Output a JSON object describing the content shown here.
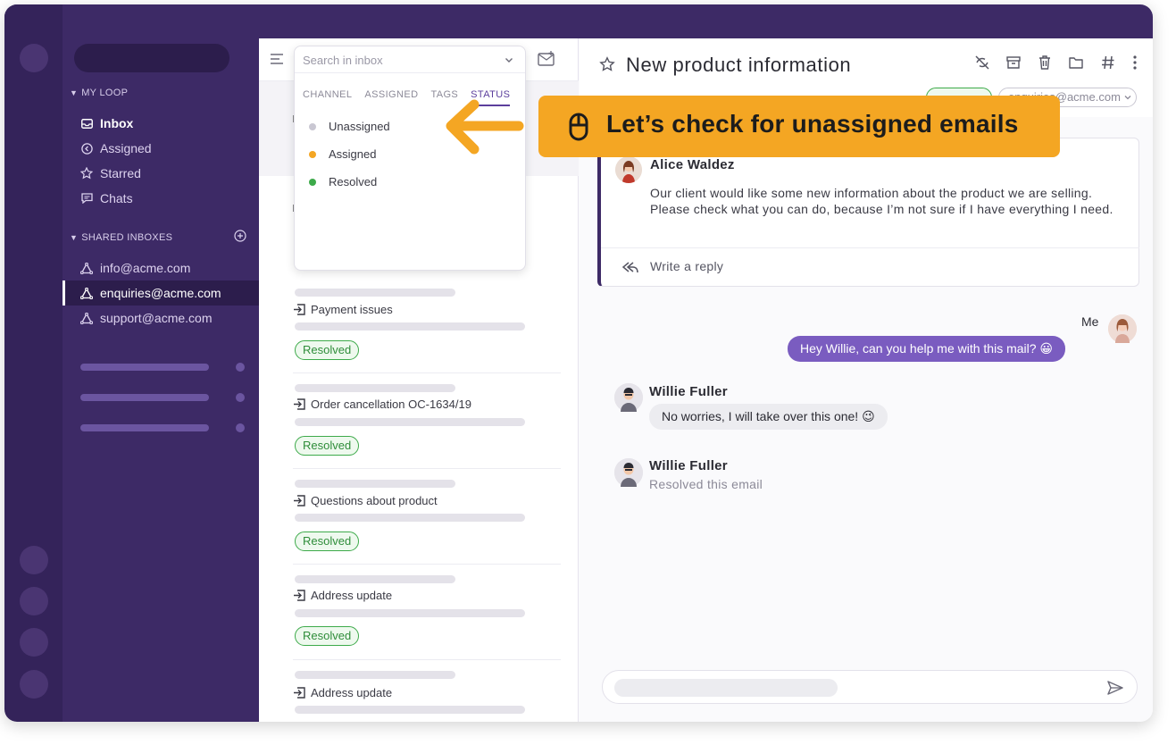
{
  "sidebar": {
    "my_loop_title": "MY LOOP",
    "my_loop_items": [
      "Inbox",
      "Assigned",
      "Starred",
      "Chats"
    ],
    "shared_title": "SHARED INBOXES",
    "shared_items": [
      "info@acme.com",
      "enquiries@acme.com",
      "support@acme.com"
    ]
  },
  "list": {
    "search_placeholder": "Search in inbox",
    "filter_tabs": [
      "CHANNEL",
      "ASSIGNED",
      "TAGS",
      "STATUS"
    ],
    "status_options": [
      {
        "label": "Unassigned",
        "color": "#c9c7d2"
      },
      {
        "label": "Assigned",
        "color": "#f4a623"
      },
      {
        "label": "Resolved",
        "color": "#3daa4a"
      }
    ],
    "items": [
      {
        "subject": "Payment issues",
        "badge": "Resolved"
      },
      {
        "subject": "Order cancellation OC-1634/19",
        "badge": "Resolved"
      },
      {
        "subject": "Questions about product",
        "badge": "Resolved"
      },
      {
        "subject": "Address update",
        "badge": "Resolved"
      },
      {
        "subject": "Address update"
      }
    ]
  },
  "detail": {
    "title": "New product information",
    "assignee_email": "enquiries@acme.com",
    "message": {
      "sender": "Alice Waldez",
      "body": "Our client would like some new information about the product we are selling. Please check what you can do, because I’m not sure if I have everything I need.",
      "reply_label": "Write a reply"
    },
    "chat": {
      "me_label": "Me",
      "me_message": "Hey Willie, can you help me with this mail? 😀",
      "willie_name": "Willie Fuller",
      "willie_message": "No worries, I will take over this one! 😉",
      "resolved_note": "Resolved this email"
    }
  },
  "overlay": {
    "banner_text": "Let’s check for unassigned emails"
  },
  "colors": {
    "sidebar": "#3d2a66",
    "accent": "#7a5cc0",
    "banner": "#f4a623",
    "resolved": "#3daa4a"
  }
}
